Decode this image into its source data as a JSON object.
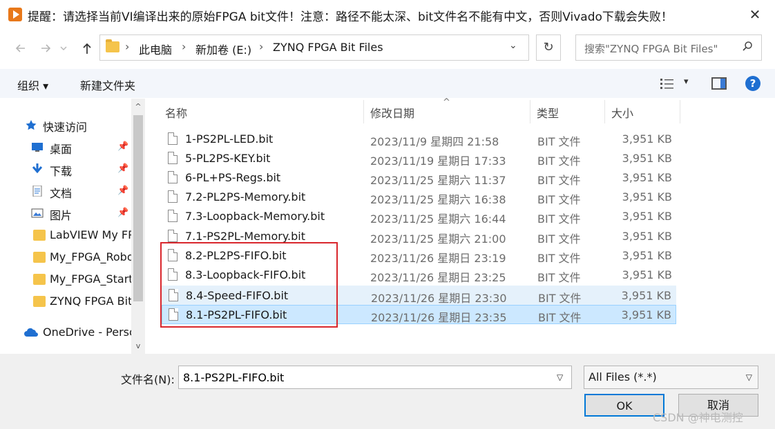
{
  "window": {
    "title": "提醒：请选择当前VI编译出来的原始FPGA bit文件！注意：路径不能太深、bit文件名不能有中文，否则Vivado下载会失败！",
    "close_glyph": "✕"
  },
  "address": {
    "crumbs": [
      "此电脑",
      "新加卷 (E:)",
      "ZYNQ FPGA Bit Files"
    ],
    "search_placeholder": "搜索\"ZYNQ FPGA Bit Files\""
  },
  "toolbar": {
    "organize_label": "组织 ▾",
    "new_folder_label": "新建文件夹",
    "help_label": "?"
  },
  "nav": {
    "items": [
      {
        "label": "快速访问",
        "icon": "star-icon"
      },
      {
        "label": "桌面",
        "icon": "desktop-icon",
        "pinned": true
      },
      {
        "label": "下载",
        "icon": "download-icon",
        "pinned": true
      },
      {
        "label": "文档",
        "icon": "document-icon",
        "pinned": true
      },
      {
        "label": "图片",
        "icon": "picture-icon",
        "pinned": true
      },
      {
        "label": "LabVIEW My FPGA",
        "icon": "folder-icon"
      },
      {
        "label": "My_FPGA_Robot",
        "icon": "folder-icon"
      },
      {
        "label": "My_FPGA_Starter",
        "icon": "folder-icon"
      },
      {
        "label": "ZYNQ FPGA Bit Files",
        "icon": "folder-icon"
      },
      {
        "label": "OneDrive - Personal",
        "icon": "cloud-icon"
      }
    ]
  },
  "columns": {
    "name": "名称",
    "date": "修改日期",
    "type": "类型",
    "size": "大小"
  },
  "files": [
    {
      "name": "1-PS2PL-LED.bit",
      "date": "2023/11/9 星期四 21:58",
      "type": "BIT 文件",
      "size": "3,951 KB"
    },
    {
      "name": "5-PL2PS-KEY.bit",
      "date": "2023/11/19 星期日 17:33",
      "type": "BIT 文件",
      "size": "3,951 KB"
    },
    {
      "name": "6-PL+PS-Regs.bit",
      "date": "2023/11/25 星期六 11:37",
      "type": "BIT 文件",
      "size": "3,951 KB"
    },
    {
      "name": "7.2-PL2PS-Memory.bit",
      "date": "2023/11/25 星期六 16:38",
      "type": "BIT 文件",
      "size": "3,951 KB"
    },
    {
      "name": "7.3-Loopback-Memory.bit",
      "date": "2023/11/25 星期六 16:44",
      "type": "BIT 文件",
      "size": "3,951 KB"
    },
    {
      "name": "7.1-PS2PL-Memory.bit",
      "date": "2023/11/25 星期六 21:00",
      "type": "BIT 文件",
      "size": "3,951 KB"
    },
    {
      "name": "8.2-PL2PS-FIFO.bit",
      "date": "2023/11/26 星期日 23:19",
      "type": "BIT 文件",
      "size": "3,951 KB"
    },
    {
      "name": "8.3-Loopback-FIFO.bit",
      "date": "2023/11/26 星期日 23:25",
      "type": "BIT 文件",
      "size": "3,951 KB"
    },
    {
      "name": "8.4-Speed-FIFO.bit",
      "date": "2023/11/26 星期日 23:30",
      "type": "BIT 文件",
      "size": "3,951 KB",
      "state": "hover"
    },
    {
      "name": "8.1-PS2PL-FIFO.bit",
      "date": "2023/11/26 星期日 23:35",
      "type": "BIT 文件",
      "size": "3,951 KB",
      "state": "selected"
    }
  ],
  "footer": {
    "filename_label": "文件名(N):",
    "filename_value": "8.1-PS2PL-FIFO.bit",
    "filetype_value": "All Files (*.*)",
    "ok_label": "OK",
    "cancel_label": "取消",
    "watermark": "CSDN @神电测控"
  },
  "colors": {
    "accent": "#0078d7",
    "highlight_box": "#d9262c",
    "selected_row": "#cce8ff"
  }
}
